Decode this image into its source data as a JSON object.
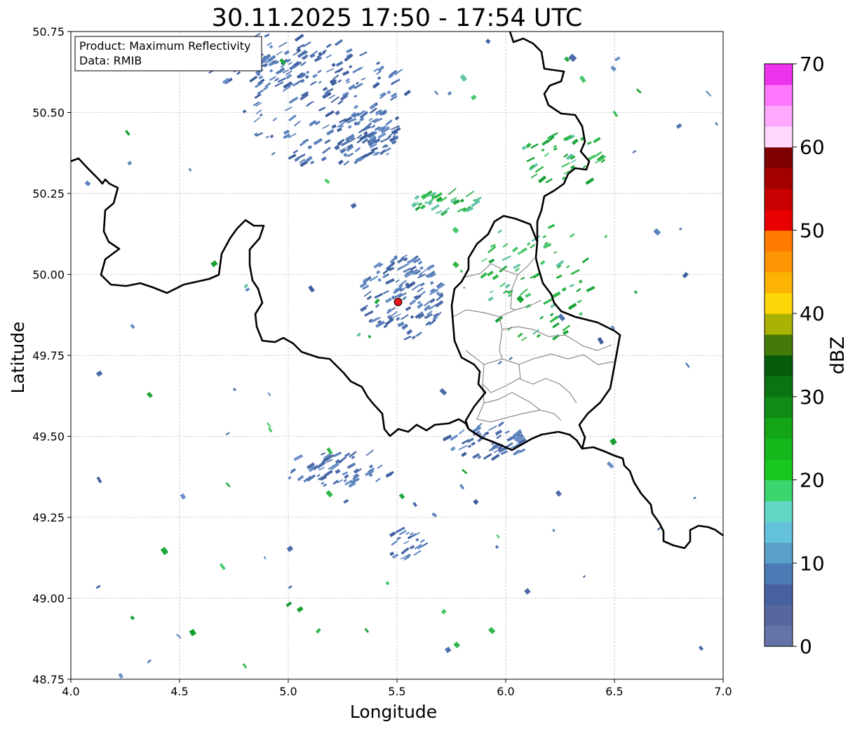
{
  "title": "30.11.2025 17:50 - 17:54 UTC",
  "info_box": {
    "product_line": "Product: Maximum Reflectivity",
    "data_line": "Data: RMIB"
  },
  "axes": {
    "xlabel": "Longitude",
    "ylabel": "Latitude",
    "x_range": [
      4.0,
      7.0
    ],
    "y_range": [
      48.75,
      50.75
    ],
    "x_ticks": [
      "4.0",
      "4.5",
      "5.0",
      "5.5",
      "6.0",
      "6.5",
      "7.0"
    ],
    "y_ticks": [
      "48.75",
      "49.00",
      "49.25",
      "49.50",
      "49.75",
      "50.00",
      "50.25",
      "50.50",
      "50.75"
    ],
    "grid": true
  },
  "radar_site": {
    "lon": 5.505,
    "lat": 49.915,
    "color": "#e8141c"
  },
  "colorbar": {
    "label": "dBZ",
    "min": 0,
    "max": 70,
    "ticks": [
      "0",
      "10",
      "20",
      "30",
      "40",
      "50",
      "60",
      "70"
    ],
    "colors": [
      "#6573a8",
      "#56679f",
      "#4960a0",
      "#4a7bb5",
      "#5a9fc9",
      "#64c2dc",
      "#62d8c4",
      "#3ad56c",
      "#18c81e",
      "#14b81a",
      "#12a516",
      "#0e8c14",
      "#0a7412",
      "#075c0c",
      "#467a08",
      "#aab304",
      "#fcd506",
      "#fcb304",
      "#fd9502",
      "#ff7b00",
      "#e60000",
      "#c80000",
      "#a50000",
      "#7e0000",
      "#ffd8ff",
      "#ffaaff",
      "#ff77ff",
      "#ee33ee"
    ]
  }
}
